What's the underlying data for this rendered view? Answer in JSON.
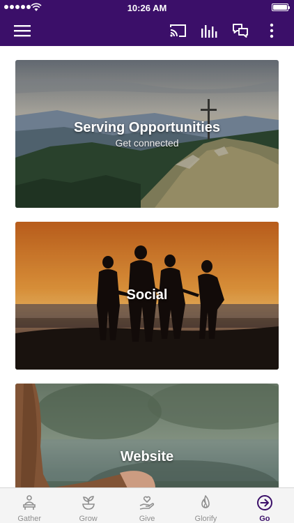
{
  "status_bar": {
    "time": "10:26 AM"
  },
  "nav_bar": {
    "icons": [
      "menu-icon",
      "cast-icon",
      "equalizer-icon",
      "chat-icon",
      "more-vertical-icon"
    ]
  },
  "cards": [
    {
      "title": "Serving Opportunities",
      "subtitle": "Get connected",
      "image": "mountain-cross-landscape"
    },
    {
      "title": "Social",
      "subtitle": "",
      "image": "sunset-silhouettes"
    },
    {
      "title": "Website",
      "subtitle": "",
      "image": "hands-lake"
    }
  ],
  "tab_bar": {
    "items": [
      {
        "label": "Gather",
        "icon": "gather-icon"
      },
      {
        "label": "Grow",
        "icon": "sprout-icon"
      },
      {
        "label": "Give",
        "icon": "hand-heart-icon"
      },
      {
        "label": "Glorify",
        "icon": "flame-icon"
      },
      {
        "label": "Go",
        "icon": "arrow-circle-icon"
      }
    ],
    "active": "Go"
  },
  "colors": {
    "brand_purple": "#3b0f69",
    "tab_inactive": "#8e8e8e"
  }
}
